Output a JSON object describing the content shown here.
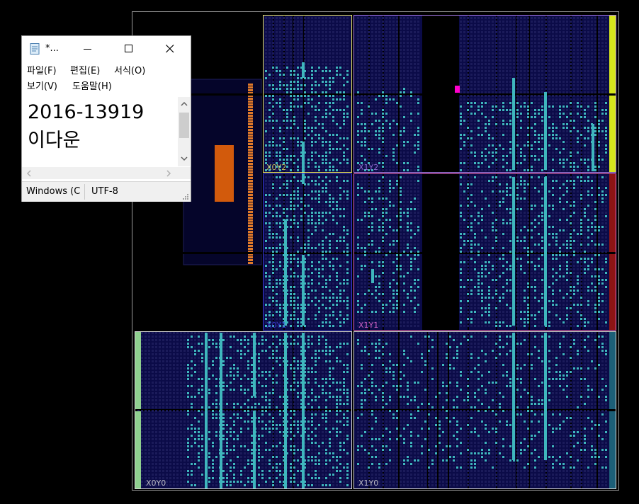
{
  "device_view": {
    "regions": [
      {
        "label": "X0Y2",
        "color": "#e8e26a"
      },
      {
        "label": "X1Y2",
        "color": "#a679e8"
      },
      {
        "label": "X0Y1",
        "color": "#3a3ad8"
      },
      {
        "label": "X1Y1",
        "color": "#e86ad2"
      },
      {
        "label": "X0Y0",
        "color": "#d8d8d8"
      },
      {
        "label": "X1Y0",
        "color": "#d8d8d8"
      }
    ],
    "colors": {
      "background": "#000000",
      "fabric": "#0b0b48",
      "cell": "#1b1b5a",
      "placed_cell": "#3fb6bd",
      "column": "#3fb6bd",
      "io_block": "#d25a0c",
      "io_pins": "#e07a2a",
      "marker": "#ff00cc",
      "bank_yellow": "#d6e61c",
      "bank_red": "#8e1414",
      "bank_teal": "#1c5f78",
      "bank_green": "#8fd08f"
    }
  },
  "notepad": {
    "title": "*...",
    "menu": {
      "file": "파일(F)",
      "edit": "편집(E)",
      "format": "서식(O)",
      "view": "보기(V)",
      "help": "도움말(H)"
    },
    "content_lines": [
      "2016-13919",
      "이다운"
    ],
    "status": {
      "line_ending": "Windows (C",
      "encoding": "UTF-8"
    }
  }
}
